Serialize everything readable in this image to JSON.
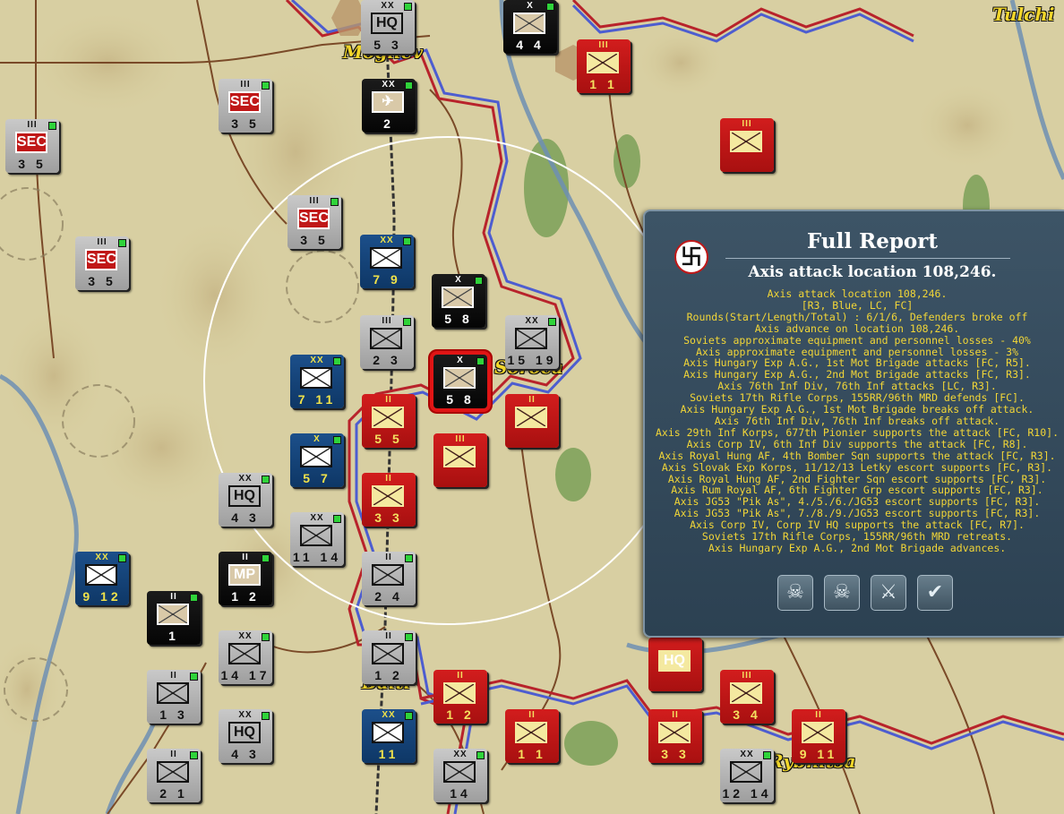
{
  "towns": {
    "mogilev": "Mogilev",
    "tulchin": "Tulchi",
    "soroca": "Soroca",
    "balti": "Balti",
    "rybnitsa": "Rybnitsa"
  },
  "counters": [
    {
      "side": "grey",
      "size": "III",
      "sym": "SEC",
      "fac": "3 5"
    },
    {
      "side": "grey",
      "size": "III",
      "sym": "SEC",
      "fac": "3 5"
    },
    {
      "side": "grey",
      "size": "III",
      "sym": "SEC",
      "fac": "3 5"
    },
    {
      "side": "grey",
      "size": "III",
      "sym": "SEC",
      "fac": "3 5"
    },
    {
      "side": "grey",
      "size": "XX",
      "sym": "HQ",
      "fac": "5 3"
    },
    {
      "side": "black",
      "size": "XX",
      "sym": "✈",
      "fac": "2"
    },
    {
      "side": "black",
      "size": "X",
      "sym": "",
      "fac": "4 4"
    },
    {
      "side": "blue",
      "size": "XX",
      "sym": "",
      "fac": "7 9"
    },
    {
      "side": "black",
      "size": "X",
      "sym": "",
      "fac": "5 8"
    },
    {
      "side": "grey",
      "size": "XX",
      "sym": "",
      "fac": "15 19"
    },
    {
      "side": "grey",
      "size": "III",
      "sym": "",
      "fac": "2 3"
    },
    {
      "side": "black",
      "size": "X",
      "sym": "",
      "fac": "5 8"
    },
    {
      "side": "blue",
      "size": "XX",
      "sym": "",
      "fac": "7 11"
    },
    {
      "side": "blue",
      "size": "X",
      "sym": "",
      "fac": "5 7"
    },
    {
      "side": "grey",
      "size": "XX",
      "sym": "HQ",
      "fac": "4 3"
    },
    {
      "side": "grey",
      "size": "XX",
      "sym": "",
      "fac": "11 14"
    },
    {
      "side": "black",
      "size": "II",
      "sym": "MP",
      "fac": "1 2"
    },
    {
      "side": "blue",
      "size": "XX",
      "sym": "",
      "fac": "9 12"
    },
    {
      "side": "black",
      "size": "II",
      "sym": "",
      "fac": "1"
    },
    {
      "side": "grey",
      "size": "XX",
      "sym": "",
      "fac": "14 17"
    },
    {
      "side": "grey",
      "size": "II",
      "sym": "",
      "fac": "2 4"
    },
    {
      "side": "grey",
      "size": "II",
      "sym": "",
      "fac": "1 2"
    },
    {
      "side": "grey",
      "size": "II",
      "sym": "",
      "fac": "1 3"
    },
    {
      "side": "grey",
      "size": "XX",
      "sym": "HQ",
      "fac": "4 3"
    },
    {
      "side": "blue",
      "size": "XX",
      "sym": "",
      "fac": "11"
    },
    {
      "side": "grey",
      "size": "XX",
      "sym": "",
      "fac": "14"
    },
    {
      "side": "grey",
      "size": "II",
      "sym": "",
      "fac": "2 1"
    },
    {
      "side": "red",
      "size": "III",
      "sym": "",
      "fac": "1 1"
    },
    {
      "side": "red",
      "size": "III",
      "sym": "",
      "fac": ""
    },
    {
      "side": "red",
      "size": "II",
      "sym": "",
      "fac": "5 5"
    },
    {
      "side": "red",
      "size": "II",
      "sym": "",
      "fac": ""
    },
    {
      "side": "red",
      "size": "III",
      "sym": "",
      "fac": ""
    },
    {
      "side": "red",
      "size": "II",
      "sym": "",
      "fac": "3 3"
    },
    {
      "side": "red",
      "size": "II",
      "sym": "",
      "fac": "1 2"
    },
    {
      "side": "red",
      "size": "II",
      "sym": "",
      "fac": "1 1"
    },
    {
      "side": "red",
      "size": "II",
      "sym": "",
      "fac": "3 3"
    },
    {
      "side": "red",
      "size": "III",
      "sym": "",
      "fac": "3 4"
    },
    {
      "side": "red",
      "size": "II",
      "sym": "",
      "fac": "9 11"
    },
    {
      "side": "red",
      "size": "",
      "sym": "HQ",
      "fac": ""
    },
    {
      "side": "grey",
      "size": "XX",
      "sym": "",
      "fac": "12 14"
    }
  ],
  "report": {
    "title": "Full Report",
    "subtitle": "Axis attack location 108,246.",
    "lines": [
      "Axis attack location 108,246.",
      "[R3, Blue, LC, FC]",
      "Rounds(Start/Length/Total) : 6/1/6, Defenders broke off",
      "Axis advance on location 108,246.",
      "Soviets approximate equipment and personnel losses - 40%",
      "Axis approximate equipment and personnel losses - 3%",
      "Axis Hungary Exp A.G., 1st Mot Brigade attacks [FC, R5].",
      "Axis Hungary Exp A.G., 2nd Mot Brigade attacks [FC, R3].",
      "Axis 76th Inf Div, 76th Inf attacks [LC, R3].",
      "Soviets 17th Rifle Corps, 155RR/96th MRD defends [FC].",
      "Axis Hungary Exp A.G., 1st Mot Brigade breaks off attack.",
      "Axis 76th Inf Div, 76th Inf breaks off attack.",
      "Axis 29th Inf Korps, 677th Pionier supports the attack [FC, R10].",
      "Axis Corp IV, 6th Inf Div supports the attack [FC, R8].",
      "Axis Royal Hung AF, 4th Bomber Sqn supports the attack [FC, R3].",
      "Axis Slovak Exp Korps, 11/12/13 Letky escort supports [FC, R3].",
      "Axis Royal Hung AF, 2nd Fighter Sqn escort supports [FC, R3].",
      "Axis Rum Royal AF, 6th Fighter Grp escort supports [FC, R3].",
      "Axis JG53 \"Pik As\", 4./5./6./JG53 escort supports [FC, R3].",
      "Axis JG53 \"Pik As\", 7./8./9./JG53 escort supports [FC, R3].",
      "Axis Corp IV, Corp IV HQ supports the attack [FC, R7].",
      "Soviets 17th Rifle Corps, 155RR/96th MRD retreats.",
      "Axis Hungary Exp A.G., 2nd Mot Brigade advances."
    ],
    "buttons": [
      {
        "icon": "shield-skull-icon",
        "glyph": "☠"
      },
      {
        "icon": "sword-skull-icon",
        "glyph": "☠"
      },
      {
        "icon": "crossed-swords-icon",
        "glyph": "⚔"
      },
      {
        "icon": "checkmark-icon",
        "glyph": "✔"
      }
    ]
  }
}
